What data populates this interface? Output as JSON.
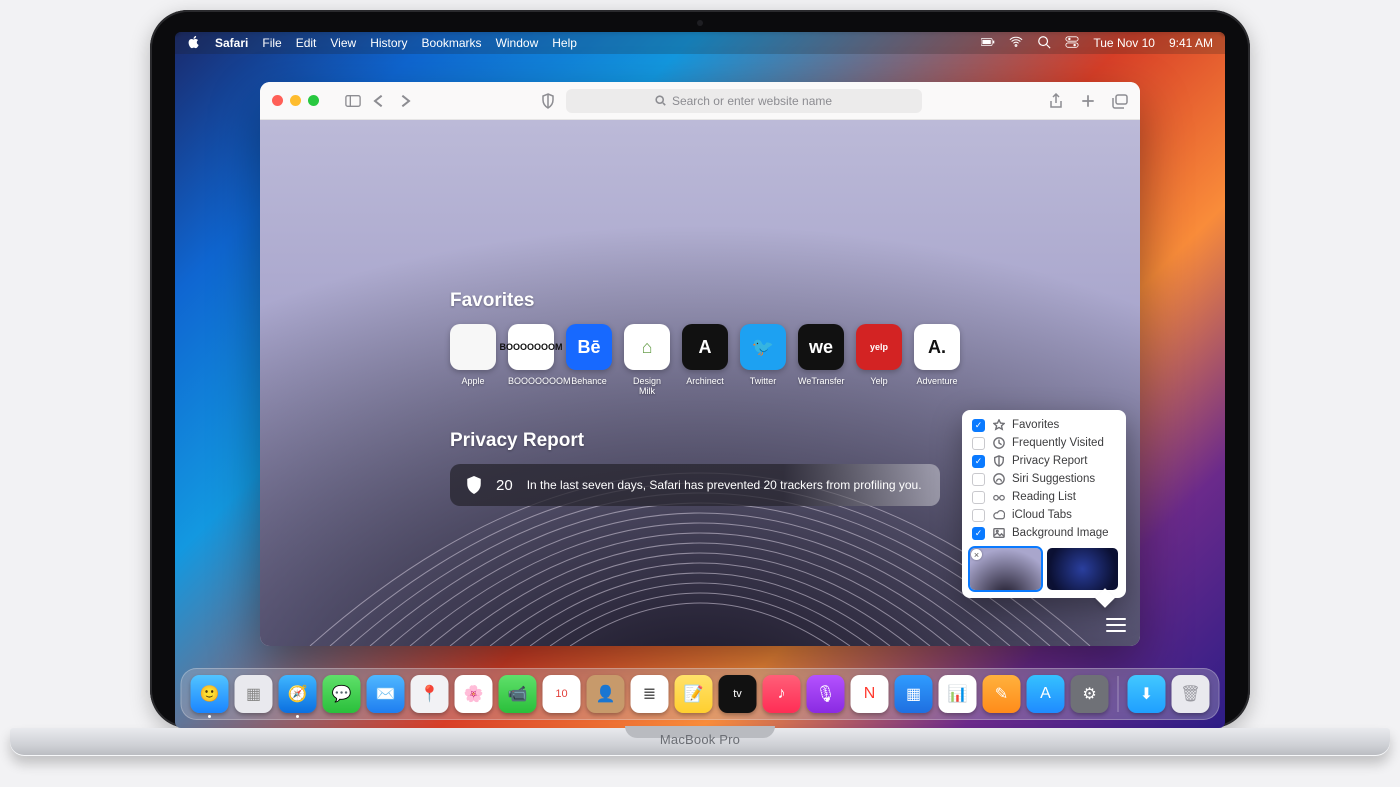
{
  "hardware": {
    "model": "MacBook Pro"
  },
  "menubar": {
    "app": "Safari",
    "items": [
      "File",
      "Edit",
      "View",
      "History",
      "Bookmarks",
      "Window",
      "Help"
    ],
    "status": {
      "date": "Tue Nov 10",
      "time": "9:41 AM"
    }
  },
  "safari": {
    "search_placeholder": "Search or enter website name",
    "sections": {
      "favorites_title": "Favorites",
      "privacy_title": "Privacy Report"
    },
    "favorites": [
      {
        "label": "Apple",
        "bg": "#f7f7f7",
        "glyph": "",
        "fg": "#555"
      },
      {
        "label": "BOOOOOOOM",
        "bg": "#ffffff",
        "glyph": "BOOOOOOOM",
        "fg": "#111",
        "small": true
      },
      {
        "label": "Behance",
        "bg": "#1769ff",
        "glyph": "Bē",
        "fg": "#fff"
      },
      {
        "label": "Design Milk",
        "bg": "#ffffff",
        "glyph": "⌂",
        "fg": "#6aa04e"
      },
      {
        "label": "Archinect",
        "bg": "#111111",
        "glyph": "A",
        "fg": "#fff"
      },
      {
        "label": "Twitter",
        "bg": "#1da1f2",
        "glyph": "🐦",
        "fg": "#fff"
      },
      {
        "label": "WeTransfer",
        "bg": "#111111",
        "glyph": "we",
        "fg": "#fff"
      },
      {
        "label": "Yelp",
        "bg": "#d32323",
        "glyph": "yelp",
        "fg": "#fff",
        "small": true
      },
      {
        "label": "Adventure",
        "bg": "#ffffff",
        "glyph": "A.",
        "fg": "#111"
      }
    ],
    "privacy": {
      "count": "20",
      "text": "In the last seven days, Safari has prevented 20 trackers from profiling you."
    },
    "customize": {
      "options": [
        {
          "label": "Favorites",
          "checked": true,
          "icon": "star"
        },
        {
          "label": "Frequently Visited",
          "checked": false,
          "icon": "clock"
        },
        {
          "label": "Privacy Report",
          "checked": true,
          "icon": "shield"
        },
        {
          "label": "Siri Suggestions",
          "checked": false,
          "icon": "siri"
        },
        {
          "label": "Reading List",
          "checked": false,
          "icon": "glasses"
        },
        {
          "label": "iCloud Tabs",
          "checked": false,
          "icon": "cloud"
        },
        {
          "label": "Background Image",
          "checked": true,
          "icon": "image"
        }
      ]
    }
  },
  "dock": {
    "apps": [
      {
        "name": "Finder",
        "bg": "linear-gradient(#52c4ff,#1a85ff)",
        "glyph": "🙂",
        "running": true
      },
      {
        "name": "Launchpad",
        "bg": "#e9e9ee",
        "glyph": "▦",
        "fg": "#888"
      },
      {
        "name": "Safari",
        "bg": "linear-gradient(#3fb6ff,#0b6fe0)",
        "glyph": "🧭",
        "running": true
      },
      {
        "name": "Messages",
        "bg": "linear-gradient(#5fe06a,#2abf3b)",
        "glyph": "💬"
      },
      {
        "name": "Mail",
        "bg": "linear-gradient(#4fb7ff,#1f7ef0)",
        "glyph": "✉️"
      },
      {
        "name": "Maps",
        "bg": "#f2f2f5",
        "glyph": "📍"
      },
      {
        "name": "Photos",
        "bg": "#ffffff",
        "glyph": "🌸"
      },
      {
        "name": "FaceTime",
        "bg": "linear-gradient(#5fe06a,#2abf3b)",
        "glyph": "📹"
      },
      {
        "name": "Calendar",
        "bg": "#ffffff",
        "glyph": "10",
        "fg": "#e2413c",
        "small": true
      },
      {
        "name": "Contacts",
        "bg": "#c79a6b",
        "glyph": "👤"
      },
      {
        "name": "Reminders",
        "bg": "#ffffff",
        "glyph": "≣",
        "fg": "#555"
      },
      {
        "name": "Notes",
        "bg": "linear-gradient(#ffe26a,#ffcf2f)",
        "glyph": "📝"
      },
      {
        "name": "TV",
        "bg": "#111111",
        "glyph": "tv",
        "small": true
      },
      {
        "name": "Music",
        "bg": "linear-gradient(#ff5f78,#ff2d55)",
        "glyph": "♪"
      },
      {
        "name": "Podcasts",
        "bg": "linear-gradient(#b452ff,#8a2be2)",
        "glyph": "🎙"
      },
      {
        "name": "News",
        "bg": "#ffffff",
        "glyph": "N",
        "fg": "#ff3b30"
      },
      {
        "name": "Keynote",
        "bg": "linear-gradient(#2f9cff,#1f6fe0)",
        "glyph": "▦"
      },
      {
        "name": "Numbers",
        "bg": "#ffffff",
        "glyph": "📊"
      },
      {
        "name": "Pages",
        "bg": "linear-gradient(#ffb13d,#ff8c1a)",
        "glyph": "✎"
      },
      {
        "name": "App Store",
        "bg": "linear-gradient(#35c1ff,#1f8bff)",
        "glyph": "A"
      },
      {
        "name": "System Preferences",
        "bg": "#6f7177",
        "glyph": "⚙︎"
      }
    ],
    "right": [
      {
        "name": "Downloads",
        "bg": "linear-gradient(#42c8ff,#1f9fff)",
        "glyph": "⬇︎"
      },
      {
        "name": "Trash",
        "bg": "#e9e9ee",
        "glyph": "🗑",
        "fg": "#9a9aa1"
      }
    ]
  }
}
